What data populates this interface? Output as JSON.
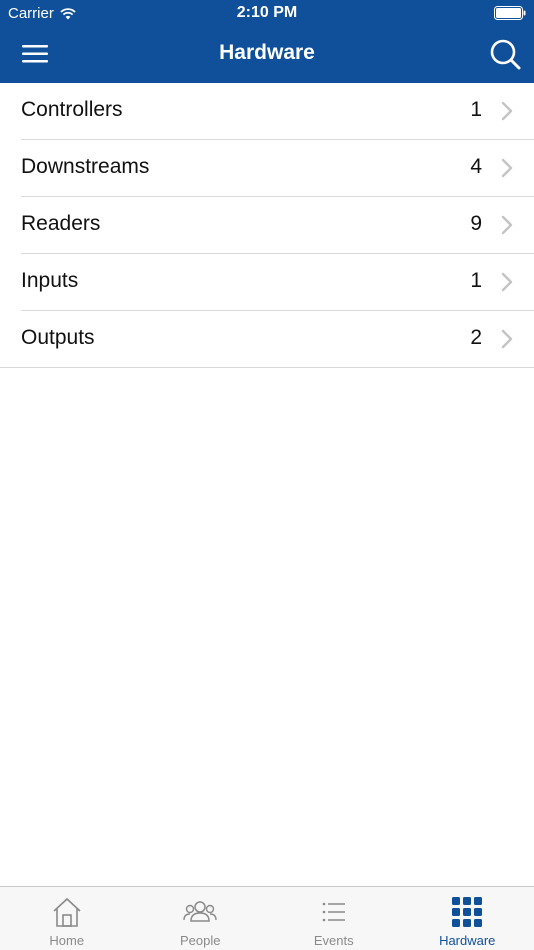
{
  "status_bar": {
    "carrier": "Carrier",
    "time": "2:10 PM"
  },
  "nav": {
    "title": "Hardware",
    "menu_icon": "hamburger-menu-icon",
    "search_icon": "search-icon"
  },
  "list": {
    "items": [
      {
        "label": "Controllers",
        "count": "1"
      },
      {
        "label": "Downstreams",
        "count": "4"
      },
      {
        "label": "Readers",
        "count": "9"
      },
      {
        "label": "Inputs",
        "count": "1"
      },
      {
        "label": "Outputs",
        "count": "2"
      }
    ]
  },
  "tabs": [
    {
      "label": "Home",
      "icon": "home-icon",
      "active": false
    },
    {
      "label": "People",
      "icon": "people-icon",
      "active": false
    },
    {
      "label": "Events",
      "icon": "events-list-icon",
      "active": false
    },
    {
      "label": "Hardware",
      "icon": "hardware-grid-icon",
      "active": true
    }
  ],
  "colors": {
    "primary": "#10509a",
    "tab_inactive": "#8a8a8a",
    "separator": "#d9d9d9"
  }
}
